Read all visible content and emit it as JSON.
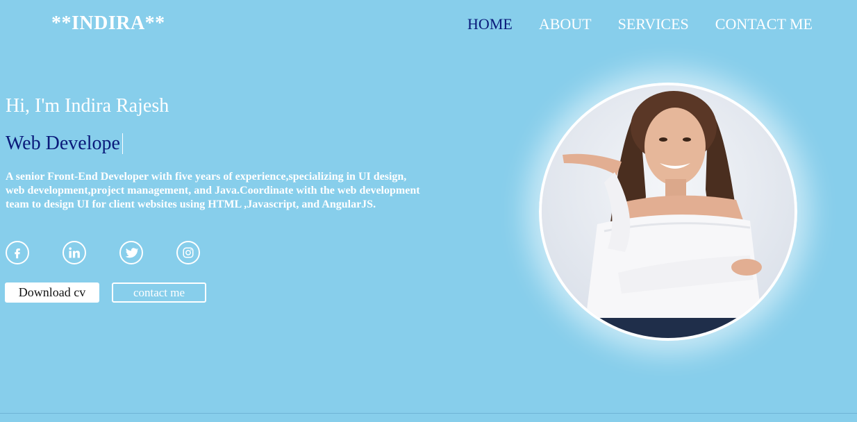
{
  "header": {
    "logo": "**INDIRA**",
    "nav": [
      {
        "label": "HOME",
        "active": true
      },
      {
        "label": "ABOUT",
        "active": false
      },
      {
        "label": "SERVICES",
        "active": false
      },
      {
        "label": "CONTACT ME",
        "active": false
      }
    ]
  },
  "hero": {
    "greeting": "Hi, I'm Indira Rajesh",
    "role_typed": "Web Develope",
    "bio": "A senior Front-End Developer with five years of experience,specializing in UI design, web development,project management, and Java.Coordinate with the web development team to design UI for client websites using HTML ,Javascript, and AngularJS.",
    "socials": [
      {
        "icon": "facebook-icon"
      },
      {
        "icon": "linkedin-icon"
      },
      {
        "icon": "twitter-icon"
      },
      {
        "icon": "instagram-icon"
      }
    ],
    "buttons": {
      "download": "Download cv",
      "contact": "contact me"
    }
  },
  "colors": {
    "background": "#87ceeb",
    "accent_text": "#0a1a7a",
    "white": "#ffffff"
  }
}
